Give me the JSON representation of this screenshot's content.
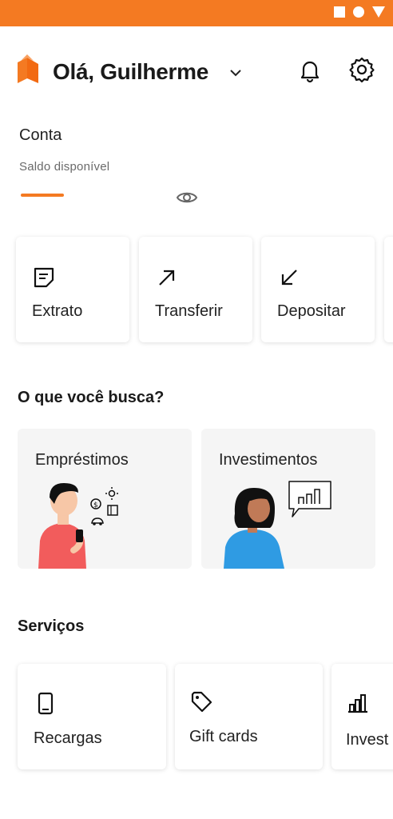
{
  "header": {
    "greeting": "Olá, Guilherme"
  },
  "account": {
    "title": "Conta",
    "subtitle": "Saldo disponível"
  },
  "actions": [
    {
      "label": "Extrato",
      "icon": "statement-icon"
    },
    {
      "label": "Transferir",
      "icon": "arrow-up-right-icon"
    },
    {
      "label": "Depositar",
      "icon": "arrow-down-left-icon"
    }
  ],
  "search": {
    "title": "O que você busca?",
    "items": [
      {
        "label": "Empréstimos"
      },
      {
        "label": "Investimentos"
      }
    ]
  },
  "services": {
    "title": "Serviços",
    "items": [
      {
        "label": "Recargas",
        "icon": "phone-icon"
      },
      {
        "label": "Gift cards",
        "icon": "tag-icon"
      },
      {
        "label": "Invest",
        "icon": "bar-chart-icon"
      }
    ]
  },
  "colors": {
    "accent": "#f47a22",
    "card_bg": "#ffffff",
    "feature_bg": "#f5f5f5"
  }
}
